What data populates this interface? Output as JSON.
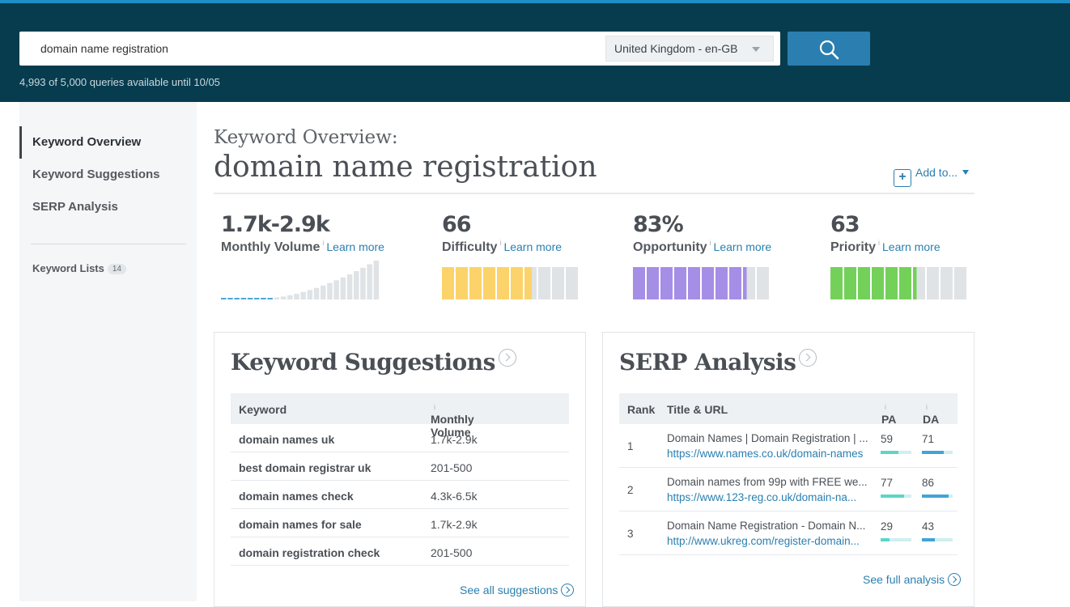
{
  "search": {
    "query": "domain name registration",
    "locale": "United Kingdom - en-GB",
    "quota_text": "4,993 of 5,000 queries available until 10/05"
  },
  "sidebar": {
    "items": [
      {
        "label": "Keyword Overview",
        "active": true
      },
      {
        "label": "Keyword Suggestions",
        "active": false
      },
      {
        "label": "SERP Analysis",
        "active": false
      }
    ],
    "lists_label": "Keyword Lists",
    "lists_count": "14"
  },
  "header": {
    "subtitle": "Keyword Overview:",
    "title": "domain name registration",
    "add_to": "Add to..."
  },
  "metrics": {
    "info_glyph": "i",
    "learn_more": "Learn more",
    "volume": {
      "value": "1.7k-2.9k",
      "label": "Monthly Volume"
    },
    "difficulty": {
      "value": "66",
      "label": "Difficulty",
      "segments": 10,
      "filled": 6.6,
      "color": "#fcd36a"
    },
    "opportunity": {
      "value": "83%",
      "label": "Opportunity",
      "segments": 10,
      "filled": 8.3,
      "color": "#a58ee6"
    },
    "priority": {
      "value": "63",
      "label": "Priority",
      "segments": 10,
      "filled": 6.3,
      "color": "#73d15a"
    }
  },
  "colors": {
    "header_bg": "#073c4f",
    "accent": "#2a7fb0",
    "empty_segment": "#dfe3e5",
    "metric_bar": "#5cd6c6",
    "metric_bar_da": "#41a4d6"
  },
  "suggestions": {
    "title": "Keyword Suggestions",
    "columns": [
      "Keyword",
      "Monthly Volume"
    ],
    "rows": [
      {
        "keyword": "domain names uk",
        "volume": "1.7k-2.9k"
      },
      {
        "keyword": "best domain registrar uk",
        "volume": "201-500"
      },
      {
        "keyword": "domain names check",
        "volume": "4.3k-6.5k"
      },
      {
        "keyword": "domain names for sale",
        "volume": "1.7k-2.9k"
      },
      {
        "keyword": "domain registration check",
        "volume": "201-500"
      }
    ],
    "see_all": "See all suggestions"
  },
  "serp": {
    "title": "SERP Analysis",
    "columns": [
      "Rank",
      "Title & URL",
      "PA",
      "DA"
    ],
    "rows": [
      {
        "rank": "1",
        "title": "Domain Names | Domain Registration | ...",
        "url": "https://www.names.co.uk/domain-names",
        "pa": "59",
        "da": "71"
      },
      {
        "rank": "2",
        "title": "Domain names from 99p with FREE we...",
        "url": "https://www.123-reg.co.uk/domain-na...",
        "pa": "77",
        "da": "86"
      },
      {
        "rank": "3",
        "title": "Domain Name Registration - Domain N...",
        "url": "http://www.ukreg.com/register-domain...",
        "pa": "29",
        "da": "43"
      }
    ],
    "see_full": "See full analysis"
  }
}
